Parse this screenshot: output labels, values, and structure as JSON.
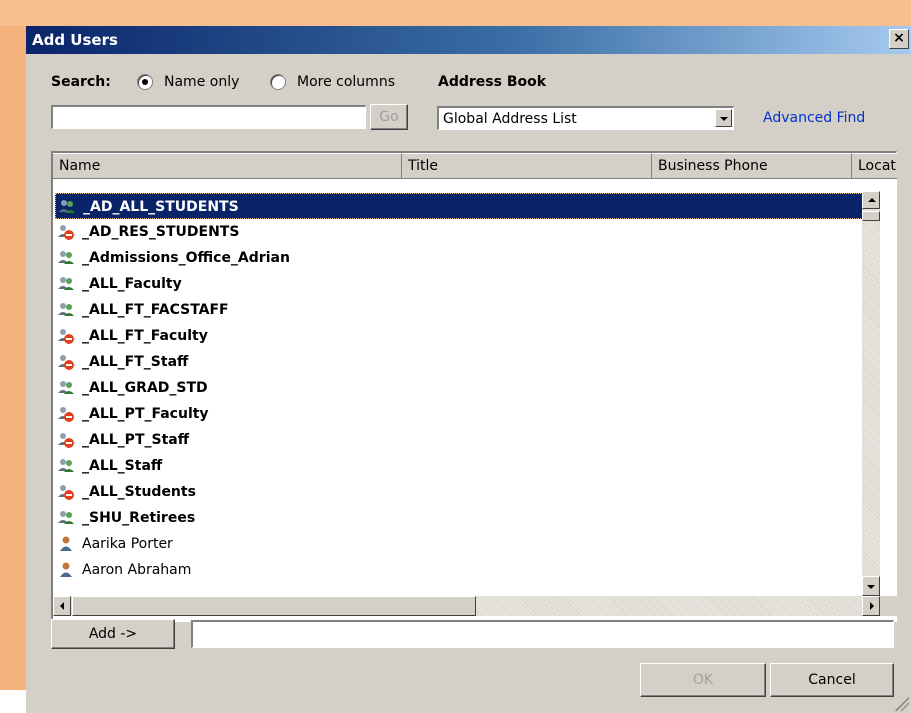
{
  "window": {
    "title": "Add Users",
    "close_label": "×"
  },
  "search": {
    "label": "Search:",
    "option_name_only": "Name only",
    "option_more_columns": "More columns",
    "selected": "Name only",
    "input_value": "",
    "go_label": "Go"
  },
  "address_book": {
    "label": "Address Book",
    "selected": "Global Address List",
    "advanced_find": "Advanced Find"
  },
  "list": {
    "columns": [
      "Name",
      "Title",
      "Business Phone",
      "Locatio"
    ],
    "rows": [
      {
        "name": "_AD_ALL_STUDENTS",
        "type": "group",
        "selected": true
      },
      {
        "name": "_AD_RES_STUDENTS",
        "type": "group-restricted"
      },
      {
        "name": "_Admissions_Office_Adrian",
        "type": "group"
      },
      {
        "name": "_ALL_Faculty",
        "type": "group"
      },
      {
        "name": "_ALL_FT_FACSTAFF",
        "type": "group"
      },
      {
        "name": "_ALL_FT_Faculty",
        "type": "group-restricted"
      },
      {
        "name": "_ALL_FT_Staff",
        "type": "group-restricted"
      },
      {
        "name": "_ALL_GRAD_STD",
        "type": "group"
      },
      {
        "name": "_ALL_PT_Faculty",
        "type": "group-restricted"
      },
      {
        "name": "_ALL_PT_Staff",
        "type": "group-restricted"
      },
      {
        "name": "_ALL_Staff",
        "type": "group"
      },
      {
        "name": "_ALL_Students",
        "type": "group-restricted"
      },
      {
        "name": "_SHU_Retirees",
        "type": "group"
      },
      {
        "name": "Aarika Porter",
        "type": "user"
      },
      {
        "name": "Aaron Abraham",
        "type": "user"
      }
    ]
  },
  "add": {
    "button_label": "Add ->",
    "field_value": ""
  },
  "footer": {
    "ok_label": "OK",
    "cancel_label": "Cancel"
  },
  "colors": {
    "selection": "#0a246a",
    "link": "#0033cc",
    "dialog": "#d4d0c8",
    "background": "#f4b27c"
  }
}
